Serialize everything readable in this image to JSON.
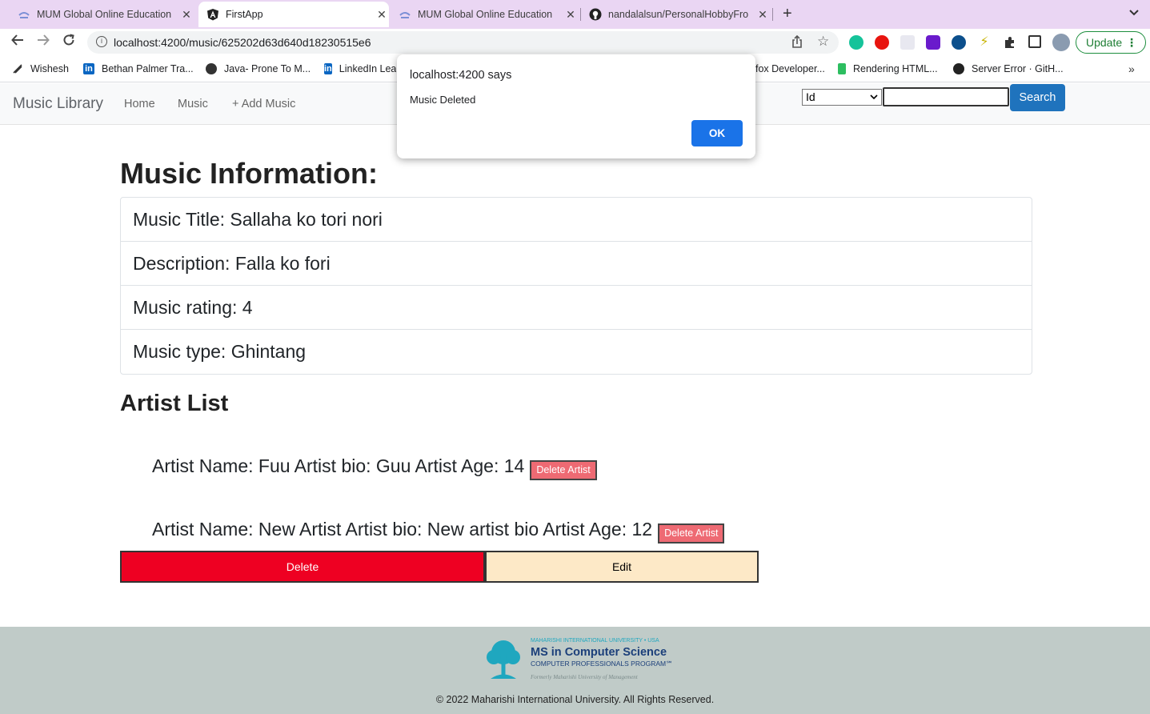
{
  "browser": {
    "tabs": [
      {
        "title": "MUM Global Online Education",
        "active": false
      },
      {
        "title": "FirstApp",
        "active": true
      },
      {
        "title": "MUM Global Online Education",
        "active": false
      },
      {
        "title": "nandalalsun/PersonalHobbyFro",
        "active": false
      }
    ],
    "close_glyph": "✕",
    "new_tab_glyph": "+",
    "url": "localhost:4200/music/625202d63d640d18230515e6",
    "update_label": "Update",
    "bookmarks": [
      {
        "label": "Wishesh",
        "icon": "wishesh-icon"
      },
      {
        "label": "Bethan Palmer Tra...",
        "icon": "linkedin-icon"
      },
      {
        "label": "Java- Prone To M...",
        "icon": "globe-icon"
      },
      {
        "label": "LinkedIn Lea",
        "icon": "linkedin-icon"
      },
      {
        "label": "fox Developer...",
        "icon": "firefox-icon"
      },
      {
        "label": "Rendering HTML...",
        "icon": "evernote-icon"
      },
      {
        "label": "Server Error · GitH...",
        "icon": "github-icon"
      }
    ]
  },
  "app": {
    "brand": "Music Library",
    "nav": [
      "Home",
      "Music",
      "+ Add Music"
    ],
    "search": {
      "select_value": "Id",
      "input_value": "",
      "button_label": "Search"
    }
  },
  "music": {
    "heading": "Music Information:",
    "details": [
      "Music Title: Sallaha ko tori nori",
      "Description: Falla ko fori",
      "Music rating: 4",
      "Music type: Ghintang"
    ]
  },
  "artists": {
    "heading": "Artist List",
    "items": [
      {
        "text": "Artist Name: Fuu Artist bio: Guu Artist Age: 14",
        "button": "Delete Artist"
      },
      {
        "text": "Artist Name: New Artist Artist bio: New artist bio Artist Age: 12",
        "button": "Delete Artist"
      }
    ]
  },
  "actions": {
    "delete_label": "Delete",
    "edit_label": "Edit"
  },
  "footer": {
    "logo_top": "MAHARISHI INTERNATIONAL UNIVERSITY • USA",
    "logo_main": "MS in Computer Science",
    "logo_sub": "COMPUTER PROFESSIONALS PROGRAM℠",
    "logo_note": "Formerly Maharishi University of Management",
    "copyright": "© 2022 Maharishi International University. All Rights Reserved."
  },
  "alert": {
    "origin": "localhost:4200 says",
    "message": "Music Deleted",
    "ok_label": "OK"
  },
  "colors": {
    "tab_strip": "#ead6f3",
    "search_button": "#1f73bd",
    "delete_button": "#ee0022",
    "edit_button": "#fde9c7",
    "delete_artist_button": "#ee6a73",
    "footer": "#c0cbc8",
    "alert_ok": "#1a73e8"
  }
}
